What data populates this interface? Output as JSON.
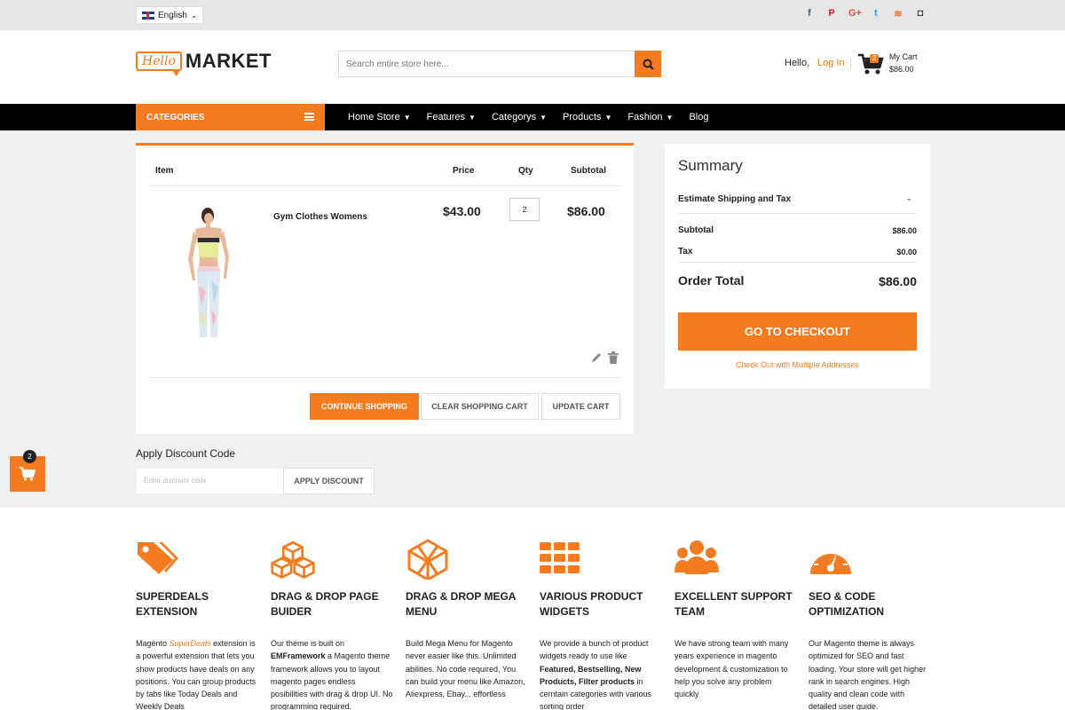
{
  "topbar": {
    "language": "English",
    "socials": [
      {
        "name": "facebook-icon",
        "glyph": "f"
      },
      {
        "name": "pinterest-icon",
        "glyph": "P"
      },
      {
        "name": "google-plus-icon",
        "glyph": "G+"
      },
      {
        "name": "twitter-icon",
        "glyph": "t"
      },
      {
        "name": "rss-icon",
        "glyph": "≋"
      },
      {
        "name": "instagram-icon",
        "glyph": "◘"
      }
    ]
  },
  "header": {
    "logo_hello": "Hello",
    "logo_market": "MARKET",
    "search_placeholder": "Search entire store here...",
    "greeting": "Hello,",
    "login": "Log In",
    "separator": "|",
    "cart_count": "2",
    "cart_label": "My Cart",
    "cart_total": "$86.00"
  },
  "nav": {
    "categories": "CATEGORIES",
    "items": [
      {
        "label": "Home Store",
        "dropdown": true
      },
      {
        "label": "Features",
        "dropdown": true
      },
      {
        "label": "Categorys",
        "dropdown": true
      },
      {
        "label": "Products",
        "dropdown": true
      },
      {
        "label": "Fashion",
        "dropdown": true
      },
      {
        "label": "Blog",
        "dropdown": false
      }
    ]
  },
  "cart": {
    "headers": {
      "item": "Item",
      "price": "Price",
      "qty": "Qty",
      "subtotal": "Subtotal"
    },
    "item": {
      "name": "Gym Clothes Womens",
      "price": "$43.00",
      "qty": "2",
      "subtotal": "$86.00"
    },
    "buttons": {
      "continue": "CONTINUE SHOPPING",
      "clear": "CLEAR SHOPPING CART",
      "update": "UPDATE CART"
    }
  },
  "discount": {
    "title": "Apply Discount Code",
    "placeholder": "Enter discount code",
    "button": "APPLY DISCOUNT"
  },
  "floating_cart": {
    "count": "2"
  },
  "summary": {
    "title": "Summary",
    "estimate": "Estimate Shipping and Tax",
    "subtotal_label": "Subtotal",
    "subtotal_value": "$86.00",
    "tax_label": "Tax",
    "tax_value": "$0.00",
    "order_total_label": "Order Total",
    "order_total_value": "$86.00",
    "checkout": "GO TO CHECKOUT",
    "multi": "Check Out with Multiple Addresses"
  },
  "features": [
    {
      "icon": "tags-icon",
      "title1": "SUPERDEALS",
      "title2": "EXTENSION"
    },
    {
      "icon": "blocks-icon",
      "title1": "DRAG & DROP PAGE",
      "title2": "BUIDER"
    },
    {
      "icon": "cube-icon",
      "title1": "DRAG & DROP MEGA",
      "title2": "MENU"
    },
    {
      "icon": "grid-icon",
      "title1": "VARIOUS PRODUCT",
      "title2": "WIDGETS"
    },
    {
      "icon": "team-icon",
      "title1": "EXCELLENT SUPPORT",
      "title2": "TEAM"
    },
    {
      "icon": "gauge-icon",
      "title1": "SEO & CODE",
      "title2": "OPTIMIZATION"
    }
  ],
  "feature_texts": {
    "f1_a": "Magento ",
    "f1_hl": "SuperDeals",
    "f1_b": " extension is a powerful extension that lets you show products have deals on any positions. You can group products by tabs like Today Deals and Weekly Deals",
    "f2_a": "Our theme is built on ",
    "f2_bold": "EMFramework",
    "f2_b": " a Magento theme framework allows you to layout magento pages endless posibilities with drag & drop UI. No programming required.",
    "f3": "Build Mega Menu for Magento never easier like this. Unlimited abilities. No code required, You can build your menu like Amazon, Aliexpress, Ebay... effortless",
    "f4_a": "We provide a bunch of product widgets ready to use like ",
    "f4_bold": "Featured, Bestselling, New Products, Filter products",
    "f4_b": " in cerntain categories with various sorting order",
    "f5": "We have strong team with many years experience in magento development & customization to help you solve any problem quickly",
    "f6": "Our Magento theme is always optimized for SEO and fast loading. Your store will get higher rank in search engines. High quality and clean code with detailed user guide."
  },
  "colors": {
    "accent": "#f47b20",
    "nav": "#000000",
    "topbar": "#e6e6e6"
  }
}
